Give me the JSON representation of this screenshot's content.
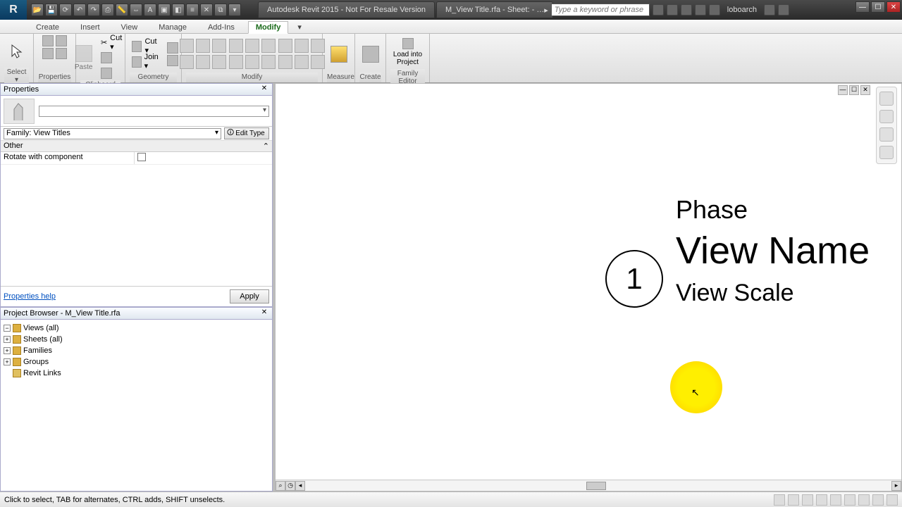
{
  "titlebar": {
    "app_name": "R",
    "doc_tabs": [
      "Autodesk Revit 2015 - Not For Resale Version",
      "M_View Title.rfa - Sheet: - …"
    ],
    "search_placeholder": "Type a keyword or phrase",
    "username": "loboarch"
  },
  "menutabs": {
    "items": [
      "Create",
      "Insert",
      "View",
      "Manage",
      "Add-Ins",
      "Modify"
    ],
    "extra_arrow": "▾",
    "active_index": 5
  },
  "ribbon": {
    "panels": {
      "select": {
        "label": "Select ▾",
        "btn": "Modify"
      },
      "properties": "Properties",
      "clipboard": {
        "label": "Clipboard",
        "paste": "Paste",
        "cut": "Cut ▾",
        "join": "Join ▾"
      },
      "geometry": "Geometry",
      "modify": "Modify",
      "measure": "Measure",
      "create": "Create",
      "family_editor": {
        "label": "Family Editor",
        "load": "Load into\nProject"
      }
    }
  },
  "properties": {
    "title": "Properties",
    "family_selector": "Family: View Titles",
    "edit_type": "Edit Type",
    "group": "Other",
    "param_name": "Rotate with component",
    "help": "Properties help",
    "apply": "Apply"
  },
  "browser": {
    "title": "Project Browser - M_View Title.rfa",
    "items": [
      "Views (all)",
      "Sheets (all)",
      "Families",
      "Groups",
      "Revit Links"
    ]
  },
  "canvas": {
    "detail_number": "1",
    "phase": "Phase",
    "view_name": "View Name",
    "view_scale": "View Scale"
  },
  "status": {
    "hint": "Click to select, TAB for alternates, CTRL adds, SHIFT unselects."
  }
}
